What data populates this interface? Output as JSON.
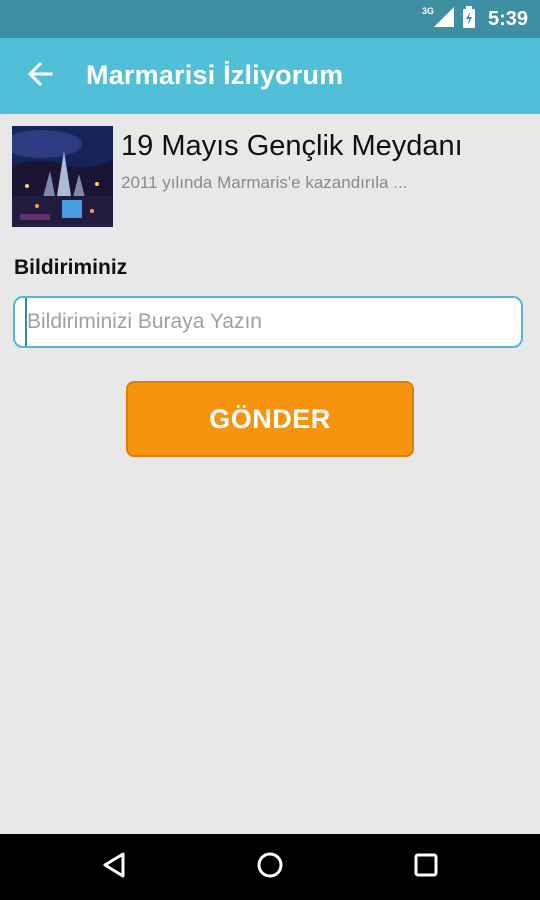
{
  "status_bar": {
    "network_type": "3G",
    "time": "5:39",
    "icons": [
      "signal-icon",
      "battery-icon"
    ]
  },
  "toolbar": {
    "back_icon": "arrow-left-icon",
    "title": "Marmarisi İzliyorum"
  },
  "item": {
    "image": "fountain-photo",
    "title": "19 Mayıs Gençlik Meydanı",
    "description": "2011 yılında Marmaris'e kazandırıla ..."
  },
  "form": {
    "label": "Bildiriminiz",
    "input_value": "",
    "input_placeholder": "Bildiriminizi Buraya Yazın",
    "submit_label": "GÖNDER"
  },
  "nav_bar": {
    "icons": [
      "back-triangle-icon",
      "home-circle-icon",
      "recents-square-icon"
    ]
  },
  "colors": {
    "status_bar": "#3d8fa1",
    "toolbar": "#52bfd8",
    "accent_button": "#f7940f",
    "input_border": "#55b8d2",
    "background": "#e8e8e8"
  }
}
